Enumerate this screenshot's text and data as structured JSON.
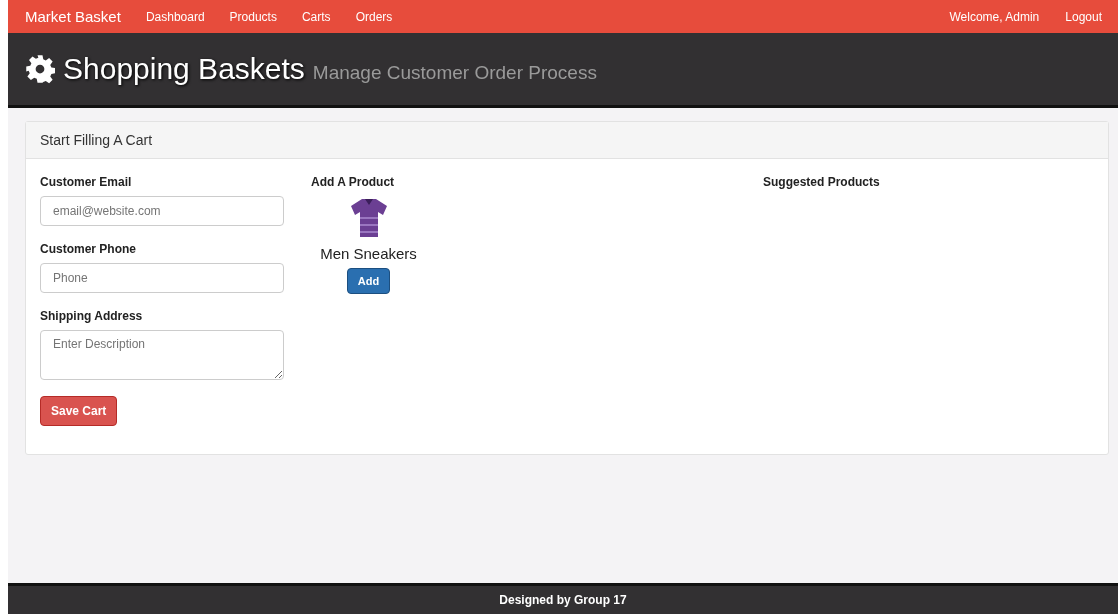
{
  "navbar": {
    "brand": "Market Basket",
    "links": [
      "Dashboard",
      "Products",
      "Carts",
      "Orders"
    ],
    "right_links": [
      "Welcome, Admin",
      "Logout"
    ]
  },
  "header": {
    "title": "Shopping Baskets",
    "subtitle": "Manage Customer Order Process"
  },
  "panel": {
    "title": "Start Filling A Cart",
    "fields": [
      {
        "label": "Customer Email",
        "placeholder": "email@website.com",
        "kind": "input"
      },
      {
        "label": "Customer Phone",
        "placeholder": "Phone",
        "kind": "input"
      },
      {
        "label": "Shipping Address",
        "placeholder": "Enter Description",
        "kind": "textarea"
      }
    ],
    "save_button": "Save Cart",
    "add_product": {
      "heading": "Add A Product",
      "product": {
        "name": "Men Sneakers",
        "kind": "picture",
        "button": "Add"
      }
    },
    "suggested": {
      "heading": "Suggested Products"
    }
  },
  "footer": "Designed by Group 17"
}
